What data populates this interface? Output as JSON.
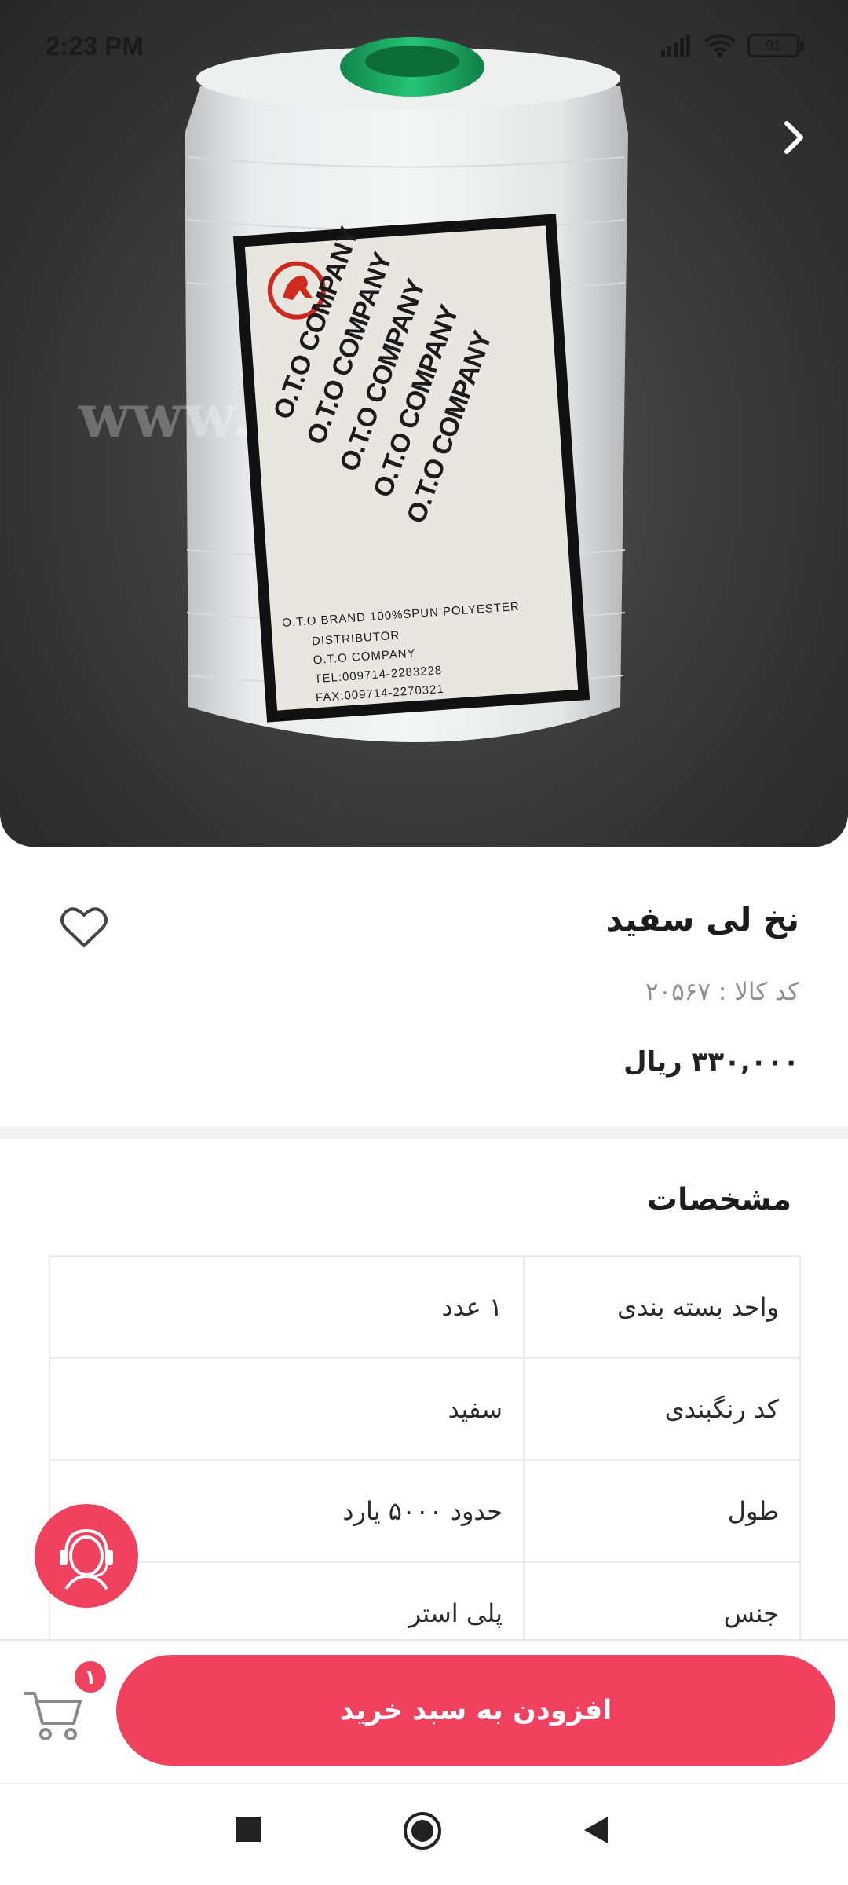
{
  "status_bar": {
    "time": "2:23 PM",
    "battery": "91"
  },
  "hero": {
    "watermark": "www.           .com",
    "label_company_lines": [
      "O.T.O COMPANY",
      "O.T.O COMPANY",
      "O.T.O COMPANY",
      "O.T.O COMPANY",
      "O.T.O COMPANY"
    ],
    "label_bottom_lines": [
      "O.T.O BRAND 100%SPUN POLYESTER",
      "DISTRIBUTOR",
      "O.T.O COMPANY",
      "TEL:009714-2283228",
      "FAX:009714-2270321"
    ]
  },
  "product": {
    "title": "نخ لی سفید",
    "code": "کد کالا : ۲۰۵۶۷",
    "price": "۳۳۰,۰۰۰ ریال"
  },
  "specs": {
    "title": "مشخصات",
    "rows": [
      {
        "key": "واحد بسته بندی",
        "value": "۱ عدد"
      },
      {
        "key": "کد رنگبندی",
        "value": "سفید"
      },
      {
        "key": "طول",
        "value": "حدود ۵۰۰۰  یارد"
      },
      {
        "key": "جنس",
        "value": "پلی استر"
      }
    ]
  },
  "bottom_bar": {
    "add_to_cart_label": "افزودن به سبد خرید",
    "cart_count": "۱"
  },
  "colors": {
    "accent": "#f0425f",
    "text": "#1c1c1c",
    "muted": "#8e8e8e"
  }
}
